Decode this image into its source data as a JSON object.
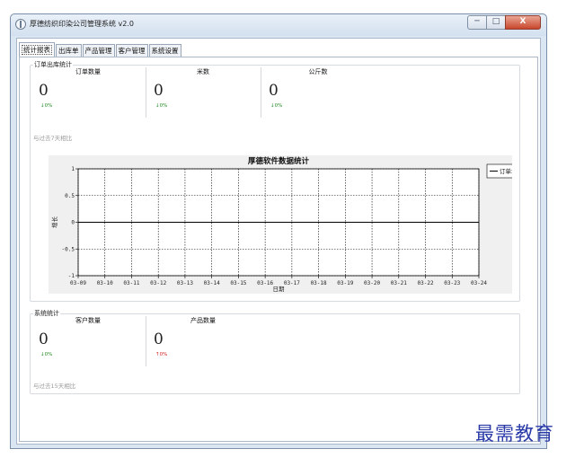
{
  "window": {
    "title": "厚德纺织印染公司管理系统 v2.0",
    "minimize": "─",
    "maximize": "□",
    "close": "X"
  },
  "tabs": [
    {
      "label": "统计报表",
      "active": true
    },
    {
      "label": "出库单"
    },
    {
      "label": "产品管理"
    },
    {
      "label": "客户管理"
    },
    {
      "label": "系统设置"
    }
  ],
  "order_stats": {
    "title": "订单出库统计",
    "items": [
      {
        "label": "订单数量",
        "value": "0",
        "change": "↓0%"
      },
      {
        "label": "米数",
        "value": "0",
        "change": "↓0%"
      },
      {
        "label": "公斤数",
        "value": "0",
        "change": "↓0%"
      }
    ],
    "compare_note": "与过去7天相比"
  },
  "chart_data": {
    "type": "line",
    "title": "厚德软件数据统计",
    "xlabel": "日期",
    "ylabel": "增长",
    "categories": [
      "03-09",
      "03-10",
      "03-11",
      "03-12",
      "03-13",
      "03-14",
      "03-15",
      "03-16",
      "03-17",
      "03-18",
      "03-19",
      "03-20",
      "03-21",
      "03-22",
      "03-23",
      "03-24"
    ],
    "yticks": [
      "1",
      "0.5",
      "0",
      "-0.5",
      "-1"
    ],
    "ylim": [
      -1,
      1
    ],
    "grid": true,
    "legend_position": "right",
    "series": [
      {
        "name": "订单增长",
        "values": [
          0,
          0,
          0,
          0,
          0,
          0,
          0,
          0,
          0,
          0,
          0,
          0,
          0,
          0,
          0,
          0
        ],
        "color": "#000000"
      }
    ]
  },
  "system_stats": {
    "title": "系统统计",
    "items": [
      {
        "label": "客户数量",
        "value": "0",
        "change": "↓0%",
        "trend": "down"
      },
      {
        "label": "产品数量",
        "value": "0",
        "change": "↑0%",
        "trend": "up"
      }
    ],
    "compare_note": "与过去15天相比"
  },
  "watermark": "最需教育",
  "colors": {
    "up": "#d02020",
    "down": "#228b22",
    "watermark": "#2a3aa8"
  }
}
